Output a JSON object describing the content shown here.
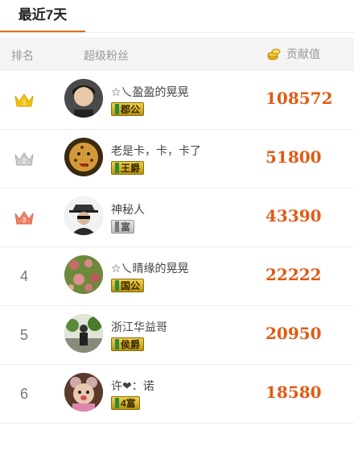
{
  "tab": {
    "label": "最近7天"
  },
  "header": {
    "rank": "排名",
    "fans": "超级粉丝",
    "contrib": "贡献值"
  },
  "colors": {
    "accent": "#e36c1b",
    "value": "#e05a14",
    "crown_gold": "#f3c214",
    "crown_silver": "#c9c9c9",
    "crown_bronze": "#f0846a"
  },
  "rows": [
    {
      "rank": "1",
      "crown": "crown-gold-icon",
      "name": "☆乀盈盈的晃晃",
      "badge": "郡公",
      "badge_style": "gold",
      "value": "108572"
    },
    {
      "rank": "2",
      "crown": "crown-silver-icon",
      "name": "老是卡，卡，卡了",
      "badge": "王爵",
      "badge_style": "gold",
      "value": "51800"
    },
    {
      "rank": "3",
      "crown": "crown-bronze-icon",
      "name": "神秘人",
      "badge": "富",
      "badge_style": "gray",
      "value": "43390"
    },
    {
      "rank": "4",
      "crown": "",
      "name": "☆乀晴缘的晃晃",
      "badge": "国公",
      "badge_style": "gold",
      "value": "22222"
    },
    {
      "rank": "5",
      "crown": "",
      "name": "浙江华益哥",
      "badge": "侯爵",
      "badge_style": "gold",
      "value": "20950"
    },
    {
      "rank": "6",
      "crown": "",
      "name": "许❤：诺",
      "badge": "4富",
      "badge_style": "gold",
      "value": "18580"
    }
  ]
}
